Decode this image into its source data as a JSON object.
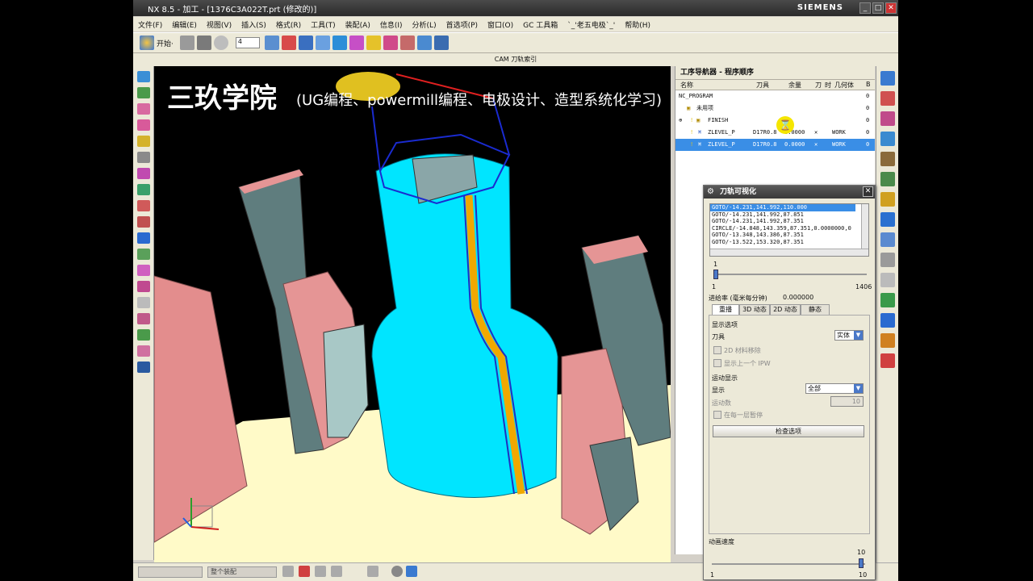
{
  "window": {
    "title": "NX 8.5 - 加工 - [1376C3A022T.prt (修改的)]",
    "brand": "SIEMENS",
    "buttons": {
      "min": "_",
      "max": "□",
      "close": "✕"
    }
  },
  "menubar": [
    "文件(F)",
    "编辑(E)",
    "视图(V)",
    "插入(S)",
    "格式(R)",
    "工具(T)",
    "装配(A)",
    "信息(I)",
    "分析(L)",
    "首选项(P)",
    "窗口(O)",
    "GC 工具箱",
    "`_'老五电极`_'",
    "帮助(H)"
  ],
  "toolbar": {
    "start_label": "开始·",
    "combo_value": "4"
  },
  "subbar": {
    "label": "CAM 刀轨索引"
  },
  "overlay": {
    "title": "三玖学院",
    "subtitle": "(UG编程、powermill编程、电极设计、造型系统化学习)"
  },
  "navigator": {
    "title": "工序导航器 - 程序顺序",
    "columns": [
      "名称",
      "刀具",
      "余量",
      "刀",
      "时",
      "几何体",
      "B"
    ],
    "rows": [
      {
        "name": "NC_PROGRAM",
        "tool": "",
        "stock": "",
        "geom": "",
        "b": "0"
      },
      {
        "name": "未用项",
        "tool": "",
        "stock": "",
        "geom": "",
        "b": "0"
      },
      {
        "name": "FINISH",
        "tool": "",
        "stock": "",
        "geom": "",
        "b": "0"
      },
      {
        "name": "ZLEVEL_P",
        "tool": "D17R0.8",
        "stock": "0.0000",
        "geom": "WORK",
        "b": "0"
      },
      {
        "name": "ZLEVEL_P",
        "tool": "D17R0.8",
        "stock": "0.0000",
        "geom": "WORK",
        "b": "0"
      }
    ]
  },
  "dialog": {
    "title": "刀轨可视化",
    "goto_lines": [
      "GOTO/-14.231,141.992,110.000",
      "GOTO/-14.231,141.992,87.851",
      "GOTO/-14.231,141.992,87.351",
      "CIRCLE/-14.848,143.359,87.351,0.0000000,0",
      "GOTO/-13.348,143.386,87.351",
      "GOTO/-13.522,153.320,87.351"
    ],
    "slider_min": "1",
    "slider_top": "1",
    "slider_max": "1406",
    "feed_label": "进给率 (毫米每分钟)",
    "feed_value": "0.000000",
    "tabs": [
      "重播",
      "3D 动态",
      "2D 动态",
      "静态"
    ],
    "display_options_label": "显示选项",
    "tool_label": "刀具",
    "tool_value": "实体",
    "chk1_label": "2D 材料移除",
    "chk2_label": "显示上一个 IPW",
    "motion_display_label": "运动显示",
    "display_label": "显示",
    "display_value": "全部",
    "motion_count_label": "运动数",
    "motion_count_value": "10",
    "chk3_label": "在每一层暂停",
    "check_options_button": "检查选项",
    "anim_speed_label": "动画速度",
    "anim_min": "1",
    "anim_max": "10",
    "anim_top": "10"
  },
  "statusbar": {
    "field1": "",
    "field2": "整个装配"
  },
  "colors": {
    "accent": "#3a8ee6",
    "part_cyan": "#00e5ff",
    "pink": "#e59595",
    "floor": "#fffac8"
  }
}
